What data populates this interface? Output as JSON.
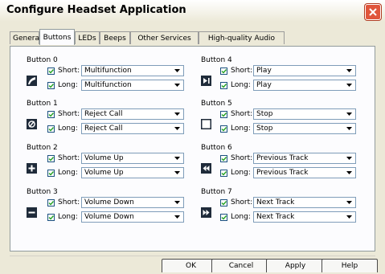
{
  "window": {
    "title": "Configure Headset Application"
  },
  "tabs": [
    "General",
    "Buttons",
    "LEDs",
    "Beeps",
    "Other Services",
    "High-quality Audio"
  ],
  "active_tab": "Buttons",
  "labels": {
    "short": "Short:",
    "long": "Long:"
  },
  "buttons": [
    {
      "name": "Button 0",
      "icon": "multifunction-icon",
      "short": "Multifunction",
      "long": "Multifunction",
      "short_checked": true,
      "long_checked": true
    },
    {
      "name": "Button 1",
      "icon": "reject-call-icon",
      "short": "Reject Call",
      "long": "Reject Call",
      "short_checked": true,
      "long_checked": true
    },
    {
      "name": "Button 2",
      "icon": "plus-icon",
      "short": "Volume Up",
      "long": "Volume Up",
      "short_checked": true,
      "long_checked": true
    },
    {
      "name": "Button 3",
      "icon": "minus-icon",
      "short": "Volume Down",
      "long": "Volume Down",
      "short_checked": true,
      "long_checked": true
    },
    {
      "name": "Button 4",
      "icon": "play-icon",
      "short": "Play",
      "long": "Play",
      "short_checked": true,
      "long_checked": true
    },
    {
      "name": "Button 5",
      "icon": "stop-icon",
      "short": "Stop",
      "long": "Stop",
      "short_checked": true,
      "long_checked": true
    },
    {
      "name": "Button 6",
      "icon": "previous-track-icon",
      "short": "Previous Track",
      "long": "Previous Track",
      "short_checked": true,
      "long_checked": true
    },
    {
      "name": "Button 7",
      "icon": "next-track-icon",
      "short": "Next Track",
      "long": "Next Track",
      "short_checked": true,
      "long_checked": true
    }
  ],
  "footer": {
    "ok": "OK",
    "cancel": "Cancel",
    "apply": "Apply",
    "help": "Help"
  },
  "colors": {
    "dialog_bg": "#ece9d8",
    "panel_bg": "#fcfcfe",
    "field_border": "#7f9db9",
    "close_red": "#e0553b"
  }
}
